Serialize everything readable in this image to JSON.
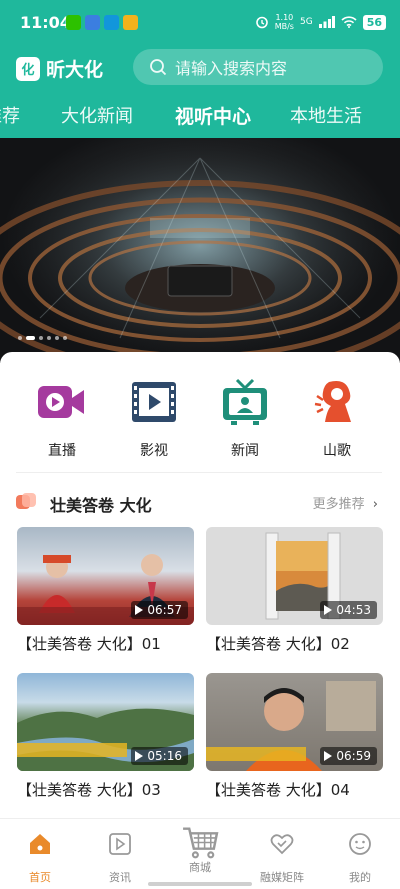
{
  "status_bar": {
    "time": "11:04",
    "net_speed_value": "1.10",
    "net_speed_unit": "MB/s",
    "network": "5G",
    "battery": "56"
  },
  "header": {
    "logo_mark": "化",
    "app_name": "昕大化",
    "search_placeholder": "请输入搜索内容"
  },
  "tabs": [
    {
      "label": "推荐",
      "active": false
    },
    {
      "label": "大化新闻",
      "active": false
    },
    {
      "label": "视听中心",
      "active": true
    },
    {
      "label": "本地生活",
      "active": false
    }
  ],
  "quick_links": [
    {
      "label": "直播",
      "icon": "video-camera-icon",
      "color": "#a53a9e"
    },
    {
      "label": "影视",
      "icon": "film-icon",
      "color": "#2f4a6b"
    },
    {
      "label": "新闻",
      "icon": "tv-news-icon",
      "color": "#1f8f7a"
    },
    {
      "label": "山歌",
      "icon": "singer-icon",
      "color": "#e5502e"
    }
  ],
  "section": {
    "title": "壮美答卷 大化",
    "more": "更多推荐"
  },
  "videos": [
    {
      "title": "【壮美答卷 大化】01",
      "duration": "06:57"
    },
    {
      "title": "【壮美答卷 大化】02",
      "duration": "04:53"
    },
    {
      "title": "【壮美答卷 大化】03",
      "duration": "05:16"
    },
    {
      "title": "【壮美答卷 大化】04",
      "duration": "06:59"
    }
  ],
  "bottom_nav": [
    {
      "label": "首页",
      "icon": "home-icon",
      "active": true
    },
    {
      "label": "资讯",
      "icon": "play-square-icon",
      "active": false
    },
    {
      "label": "商城",
      "icon": "cart-icon",
      "active": false
    },
    {
      "label": "融媒矩阵",
      "icon": "heart-link-icon",
      "active": false
    },
    {
      "label": "我的",
      "icon": "smile-icon",
      "active": false
    }
  ],
  "colors": {
    "brand": "#1fb89c",
    "nav_active": "#e98a2b"
  }
}
